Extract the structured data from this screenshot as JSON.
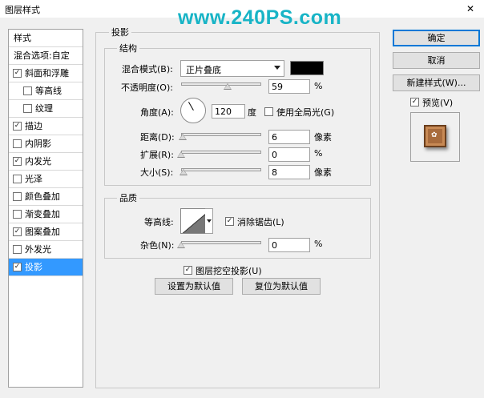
{
  "window": {
    "title": "图层样式",
    "close_glyph": "✕"
  },
  "watermark": "www.240PS.com",
  "sidebar": {
    "header": "样式",
    "items": [
      {
        "label": "混合选项:自定",
        "checkbox": false,
        "checked": false,
        "indent": false,
        "selected": false
      },
      {
        "label": "斜面和浮雕",
        "checkbox": true,
        "checked": true,
        "indent": false,
        "selected": false
      },
      {
        "label": "等高线",
        "checkbox": true,
        "checked": false,
        "indent": true,
        "selected": false
      },
      {
        "label": "纹理",
        "checkbox": true,
        "checked": false,
        "indent": true,
        "selected": false
      },
      {
        "label": "描边",
        "checkbox": true,
        "checked": true,
        "indent": false,
        "selected": false
      },
      {
        "label": "内阴影",
        "checkbox": true,
        "checked": false,
        "indent": false,
        "selected": false
      },
      {
        "label": "内发光",
        "checkbox": true,
        "checked": true,
        "indent": false,
        "selected": false
      },
      {
        "label": "光泽",
        "checkbox": true,
        "checked": false,
        "indent": false,
        "selected": false
      },
      {
        "label": "颜色叠加",
        "checkbox": true,
        "checked": false,
        "indent": false,
        "selected": false
      },
      {
        "label": "渐变叠加",
        "checkbox": true,
        "checked": false,
        "indent": false,
        "selected": false
      },
      {
        "label": "图案叠加",
        "checkbox": true,
        "checked": true,
        "indent": false,
        "selected": false
      },
      {
        "label": "外发光",
        "checkbox": true,
        "checked": false,
        "indent": false,
        "selected": false
      },
      {
        "label": "投影",
        "checkbox": true,
        "checked": true,
        "indent": false,
        "selected": true
      }
    ]
  },
  "drop_shadow": {
    "section_title": "投影",
    "structure": {
      "title": "结构",
      "blend_mode_label": "混合模式(B):",
      "blend_mode_value": "正片叠底",
      "shadow_color": "#000000",
      "opacity_label": "不透明度(O):",
      "opacity_value": "59",
      "opacity_level": 59,
      "opacity_unit": "%",
      "angle_label": "角度(A):",
      "angle_value": "120",
      "angle_unit": "度",
      "global_light_label": "使用全局光(G)",
      "global_light_checked": false,
      "distance_label": "距离(D):",
      "distance_value": "6",
      "distance_unit": "像素",
      "distance_level": 6,
      "spread_label": "扩展(R):",
      "spread_value": "0",
      "spread_unit": "%",
      "spread_level": 0,
      "size_label": "大小(S):",
      "size_value": "8",
      "size_unit": "像素",
      "size_level": 8
    },
    "quality": {
      "title": "品质",
      "contour_label": "等高线:",
      "antialias_label": "消除锯齿(L)",
      "antialias_checked": true,
      "noise_label": "杂色(N):",
      "noise_value": "0",
      "noise_unit": "%",
      "noise_level": 0
    },
    "knockout_label": "图层挖空投影(U)",
    "knockout_checked": true,
    "make_default_label": "设置为默认值",
    "reset_default_label": "复位为默认值"
  },
  "buttons": {
    "ok": "确定",
    "cancel": "取消",
    "new_style": "新建样式(W)...",
    "preview_label": "预览(V)",
    "preview_checked": true
  },
  "colors": {
    "selected": "#3399ff",
    "watermark": "#18b4c6",
    "preview_tile": "#a86b3c"
  }
}
